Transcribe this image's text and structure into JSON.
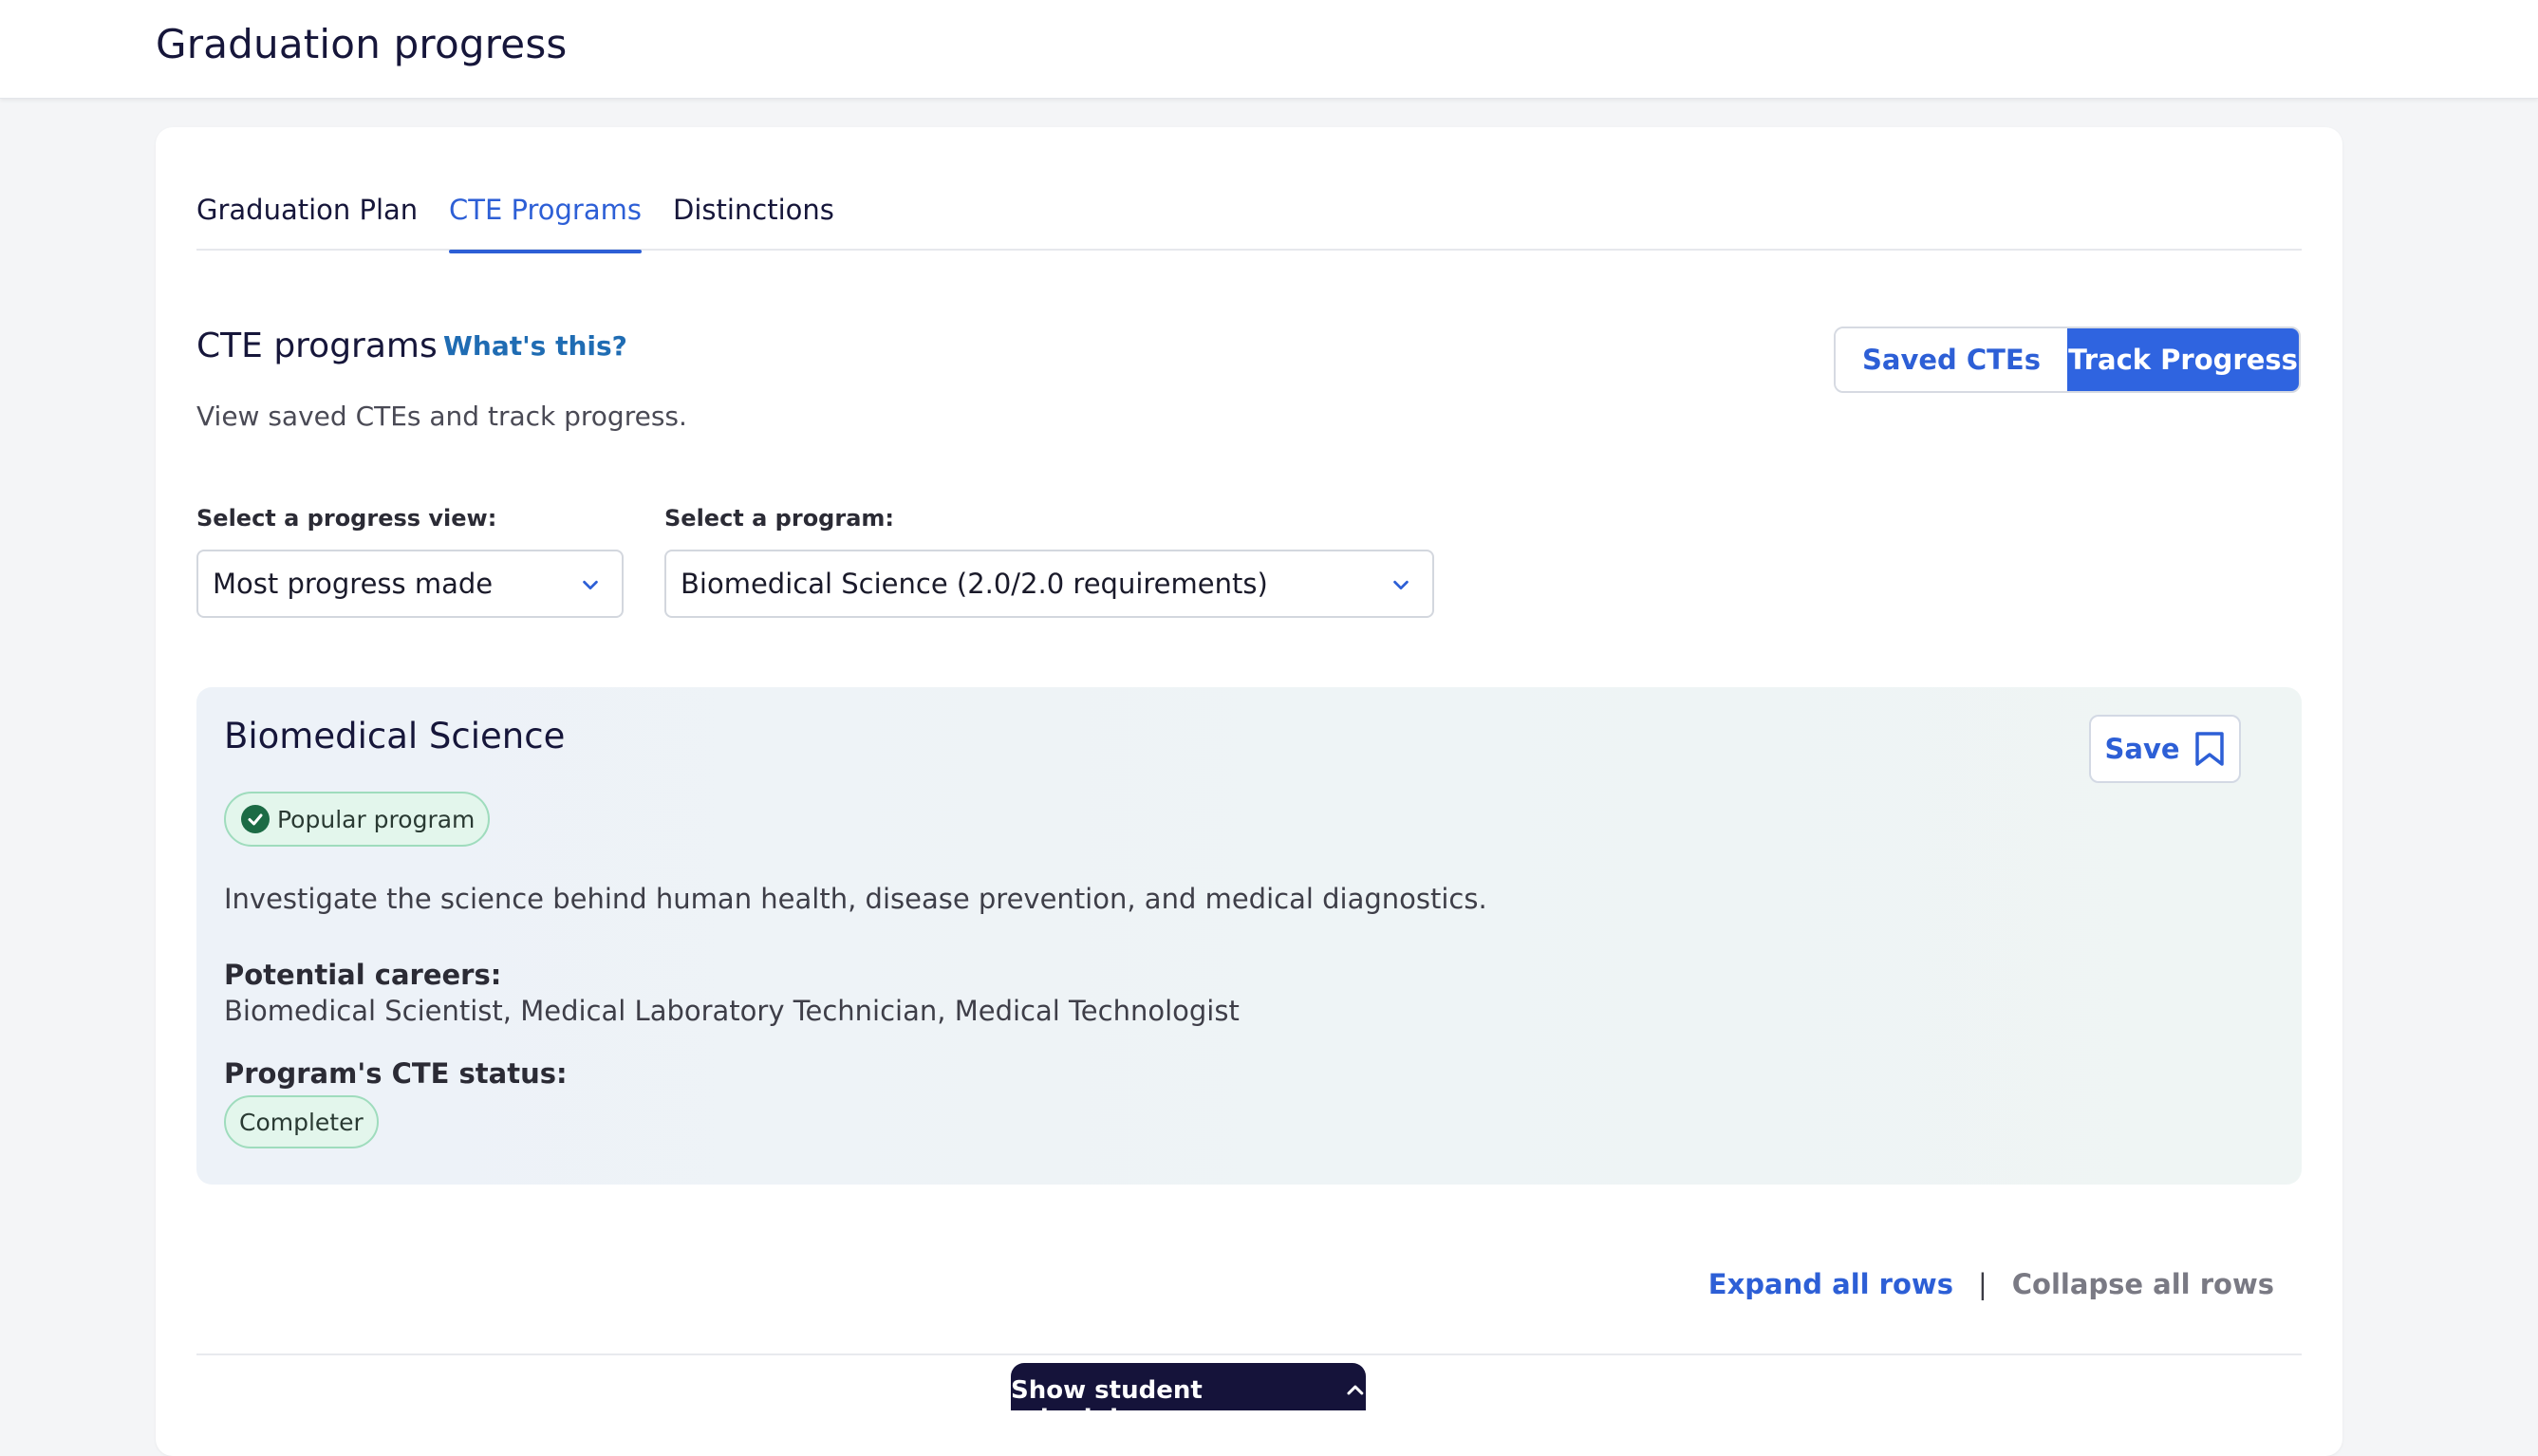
{
  "header": {
    "title": "Graduation progress"
  },
  "tabs": [
    {
      "label": "Graduation Plan",
      "active": false
    },
    {
      "label": "CTE Programs",
      "active": true
    },
    {
      "label": "Distinctions",
      "active": false
    }
  ],
  "section": {
    "title": "CTE programs",
    "help_link": "What's this?",
    "subtitle": "View saved CTEs and track progress."
  },
  "view_toggle": {
    "options": [
      "Saved CTEs",
      "Track Progress"
    ],
    "selected": "Track Progress"
  },
  "filters": {
    "progress_view": {
      "label": "Select a progress view:",
      "value": "Most progress made"
    },
    "program": {
      "label": "Select a program:",
      "value": "Biomedical Science (2.0/2.0 requirements)"
    }
  },
  "program_card": {
    "title": "Biomedical Science",
    "save_label": "Save",
    "badge": "Popular program",
    "description": "Investigate the science behind human health, disease prevention, and medical diagnostics.",
    "careers_label": "Potential careers:",
    "careers": "Biomedical Scientist, Medical Laboratory Technician, Medical Technologist",
    "status_label": "Program's CTE status:",
    "status": "Completer"
  },
  "row_actions": {
    "expand": "Expand all rows",
    "separator": "|",
    "collapse": "Collapse all rows"
  },
  "schedule_button": {
    "label": "Show student schedule"
  },
  "colors": {
    "accent": "#2d5fd6",
    "toggle_selected": "#2f64e0",
    "badge_bg": "#e3f6ec",
    "badge_border": "#9fdcbd",
    "check_icon": "#1c6b45",
    "schedule_button_bg": "#15133a"
  },
  "icons": {
    "select_chevron": "chevron-down-icon",
    "save": "bookmark-icon",
    "badge": "check-circle-icon",
    "schedule": "chevron-up-icon"
  }
}
